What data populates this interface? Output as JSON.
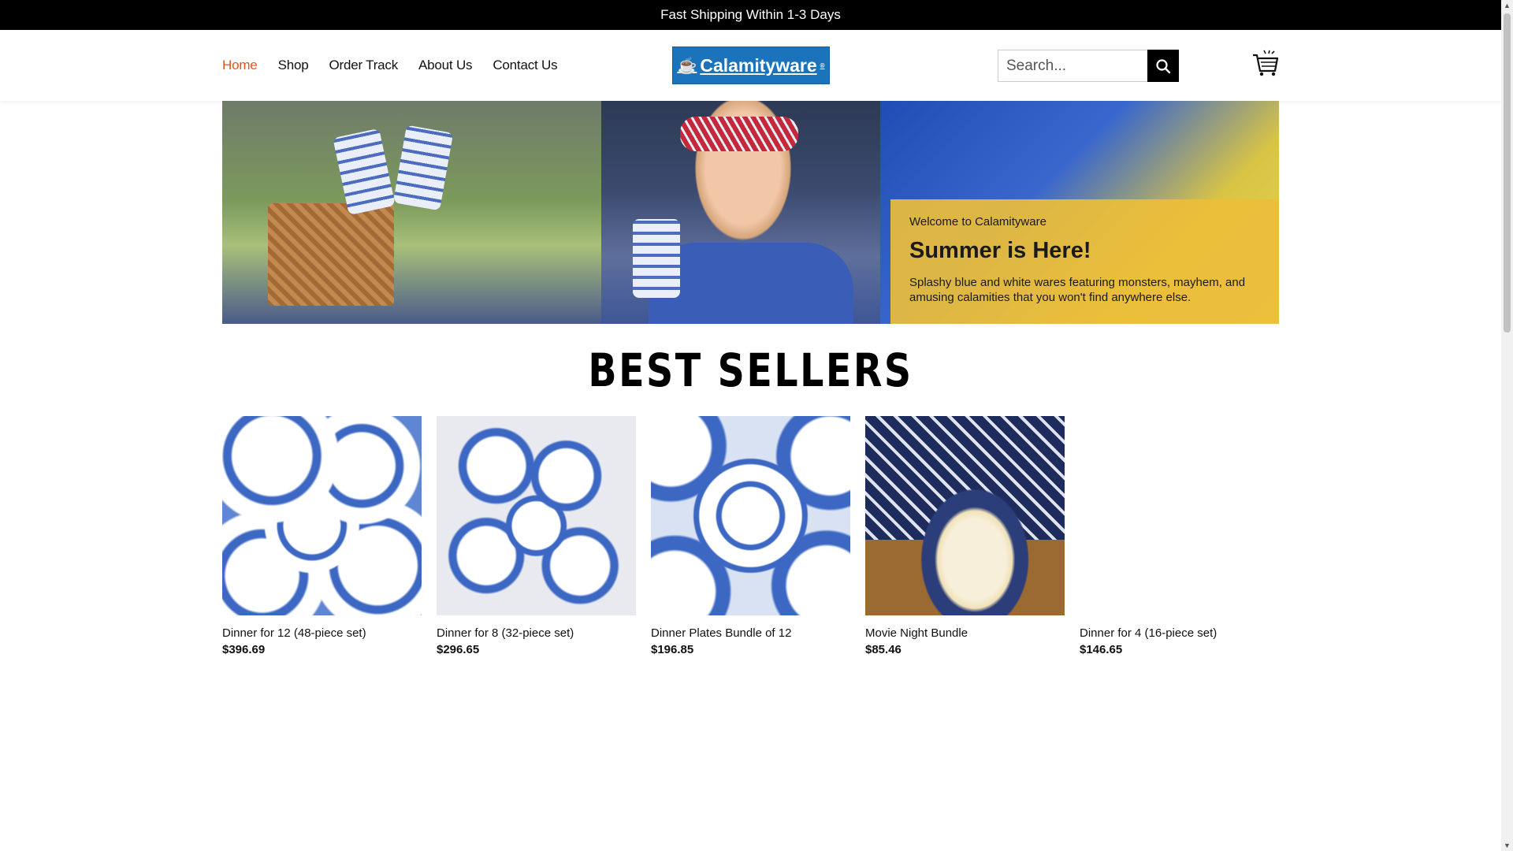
{
  "topbar": {
    "text": "Fast Shipping Within 1-3 Days"
  },
  "nav": {
    "items": [
      {
        "label": "Home",
        "active": true
      },
      {
        "label": "Shop"
      },
      {
        "label": "Order Track"
      },
      {
        "label": "About Us"
      },
      {
        "label": "Contact Us"
      }
    ]
  },
  "logo": {
    "text": "Calamityware",
    "mark": "®"
  },
  "search": {
    "placeholder": "Search..."
  },
  "hero": {
    "welcome": "Welcome to Calamityware",
    "headline": "Summer is Here!",
    "description": "Splashy blue and white wares featuring monsters, mayhem, and amusing calamities that you won't find anywhere else."
  },
  "section": {
    "title": "BEST SELLERS"
  },
  "products": [
    {
      "name": "Dinner for 12 (48-piece set)",
      "price": "$396.69"
    },
    {
      "name": "Dinner for 8 (32-piece set)",
      "price": "$296.65"
    },
    {
      "name": "Dinner Plates Bundle of 12",
      "price": "$196.85"
    },
    {
      "name": "Movie Night Bundle",
      "price": "$85.46"
    },
    {
      "name": "Dinner for 4 (16-piece set)",
      "price": "$146.65"
    }
  ],
  "colors": {
    "accent": "#e2541d",
    "brand": "#1b74bb",
    "topbar": "#000000"
  },
  "icons": {
    "search": "search-icon",
    "cart": "cart-icon"
  }
}
